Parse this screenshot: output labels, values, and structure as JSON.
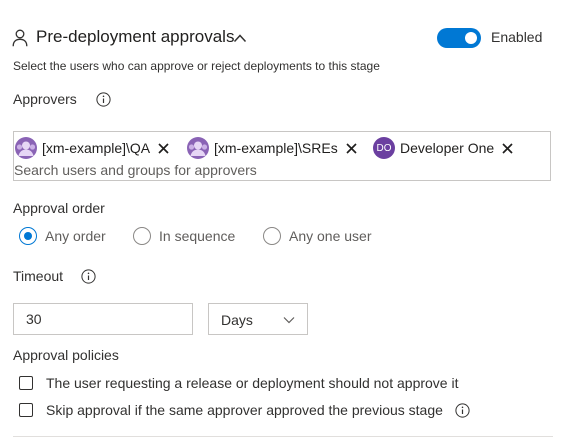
{
  "header": {
    "title": "Pre-deployment approvals",
    "toggle_label": "Enabled",
    "description": "Select the users who can approve or reject deployments to this stage"
  },
  "approvers": {
    "label": "Approvers",
    "chips": [
      {
        "label": "[xm-example]\\QA",
        "avatar": "group"
      },
      {
        "label": "[xm-example]\\SREs",
        "avatar": "group"
      },
      {
        "label": "Developer One",
        "avatar": "DO"
      }
    ],
    "placeholder": "Search users and groups for approvers"
  },
  "approval_order": {
    "label": "Approval order",
    "options": [
      "Any order",
      "In sequence",
      "Any one user"
    ],
    "selected": "Any order"
  },
  "timeout": {
    "label": "Timeout",
    "value": "30",
    "unit": "Days"
  },
  "policies": {
    "label": "Approval policies",
    "items": [
      {
        "label": "The user requesting a release or deployment should not approve it",
        "checked": false
      },
      {
        "label": "Skip approval if the same approver approved the previous stage",
        "checked": false
      }
    ]
  },
  "colors": {
    "accent": "#0078d4",
    "avatar_purple": "#6b3fa0"
  }
}
